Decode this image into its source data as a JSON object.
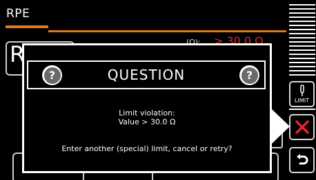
{
  "header": {
    "title": "RPE"
  },
  "background": {
    "big_letter": "R",
    "limit_label": "(Ω):",
    "limit_value": "> 30.0 Ω"
  },
  "sidebar": {
    "limit_label": "LIMIT",
    "cancel_icon": "close-icon",
    "retry_icon": "undo-icon"
  },
  "dialog": {
    "title": "QUESTION",
    "icon": "question-icon",
    "line1": "Limit violation:",
    "line2": "Value > 30.0 Ω",
    "line3": "Enter another (special) limit, cancel or retry?"
  },
  "colors": {
    "accent": "#e67817",
    "cancel": "#e8222a",
    "icon_gray": "#6a6a6a"
  }
}
